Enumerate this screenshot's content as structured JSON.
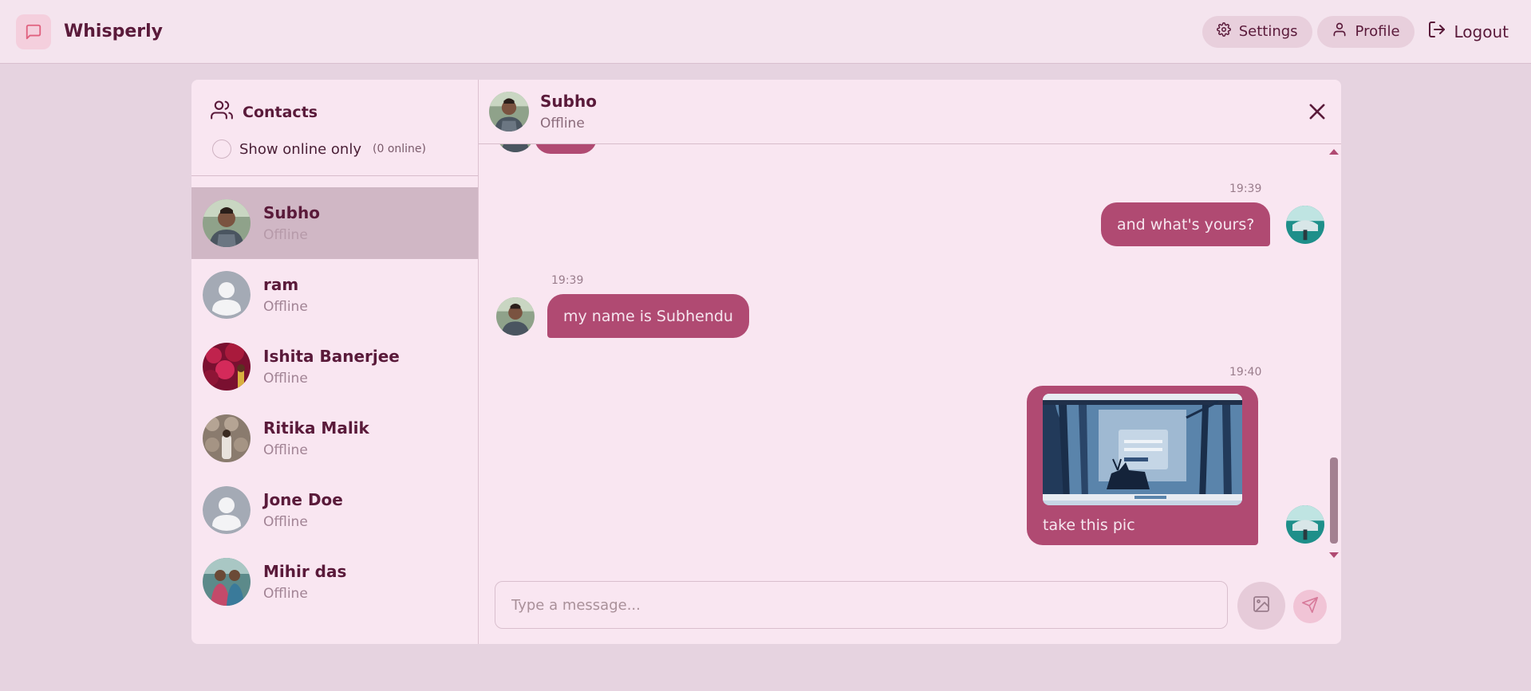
{
  "app": {
    "name": "Whisperly"
  },
  "nav": {
    "settings_label": "Settings",
    "profile_label": "Profile",
    "logout_label": "Logout"
  },
  "sidebar": {
    "title": "Contacts",
    "online_filter_label": "Show online only",
    "online_count": "(0 online)",
    "contacts": [
      {
        "name": "Subho",
        "status": "Offline",
        "avatar": "photo-subho",
        "active": true
      },
      {
        "name": "ram",
        "status": "Offline",
        "avatar": "default-avatar-icon",
        "active": false
      },
      {
        "name": "Ishita Banerjee",
        "status": "Offline",
        "avatar": "photo-flowers",
        "active": false
      },
      {
        "name": "Ritika Malik",
        "status": "Offline",
        "avatar": "photo-ritika",
        "active": false
      },
      {
        "name": "Jone Doe",
        "status": "Offline",
        "avatar": "default-avatar-icon",
        "active": false
      },
      {
        "name": "Mihir das",
        "status": "Offline",
        "avatar": "photo-mihir",
        "active": false
      }
    ]
  },
  "chat": {
    "name": "Subho",
    "status": "Offline",
    "messages": [
      {
        "time": "19:39",
        "text": "and what's yours?",
        "direction": "outgoing"
      },
      {
        "time": "19:39",
        "text": "my name is Subhendu",
        "direction": "incoming"
      },
      {
        "time": "19:40",
        "text": "take this pic",
        "direction": "outgoing",
        "has_image": true
      }
    ]
  },
  "composer": {
    "placeholder": "Type a message..."
  },
  "colors": {
    "bubble": "#b04a72",
    "page_bg": "#e6d3e0",
    "card_bg": "#f9e6f1",
    "active_contact": "#d0b7c5"
  }
}
